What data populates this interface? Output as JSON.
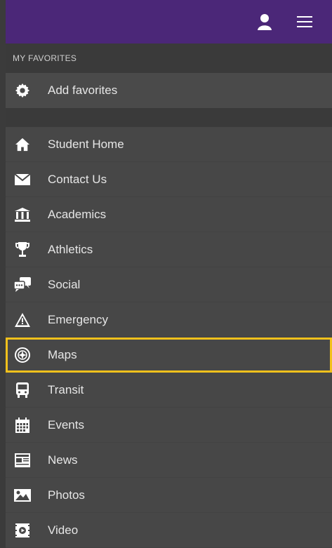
{
  "section_header": "MY FAVORITES",
  "favorites_row": {
    "label": "Add favorites",
    "icon": "gear-icon"
  },
  "menu_items": [
    {
      "label": "Student Home",
      "icon": "home-icon"
    },
    {
      "label": "Contact Us",
      "icon": "envelope-icon"
    },
    {
      "label": "Academics",
      "icon": "institution-icon"
    },
    {
      "label": "Athletics",
      "icon": "trophy-icon"
    },
    {
      "label": "Social",
      "icon": "chat-bubbles-icon"
    },
    {
      "label": "Emergency",
      "icon": "warning-icon"
    },
    {
      "label": "Maps",
      "icon": "compass-icon",
      "selected": true
    },
    {
      "label": "Transit",
      "icon": "bus-icon"
    },
    {
      "label": "Events",
      "icon": "calendar-icon"
    },
    {
      "label": "News",
      "icon": "newspaper-icon"
    },
    {
      "label": "Photos",
      "icon": "photo-icon"
    },
    {
      "label": "Video",
      "icon": "video-icon"
    }
  ],
  "colors": {
    "top_bar": "#4b2778",
    "highlight": "#f2c11c",
    "background": "#3c3c3c"
  }
}
